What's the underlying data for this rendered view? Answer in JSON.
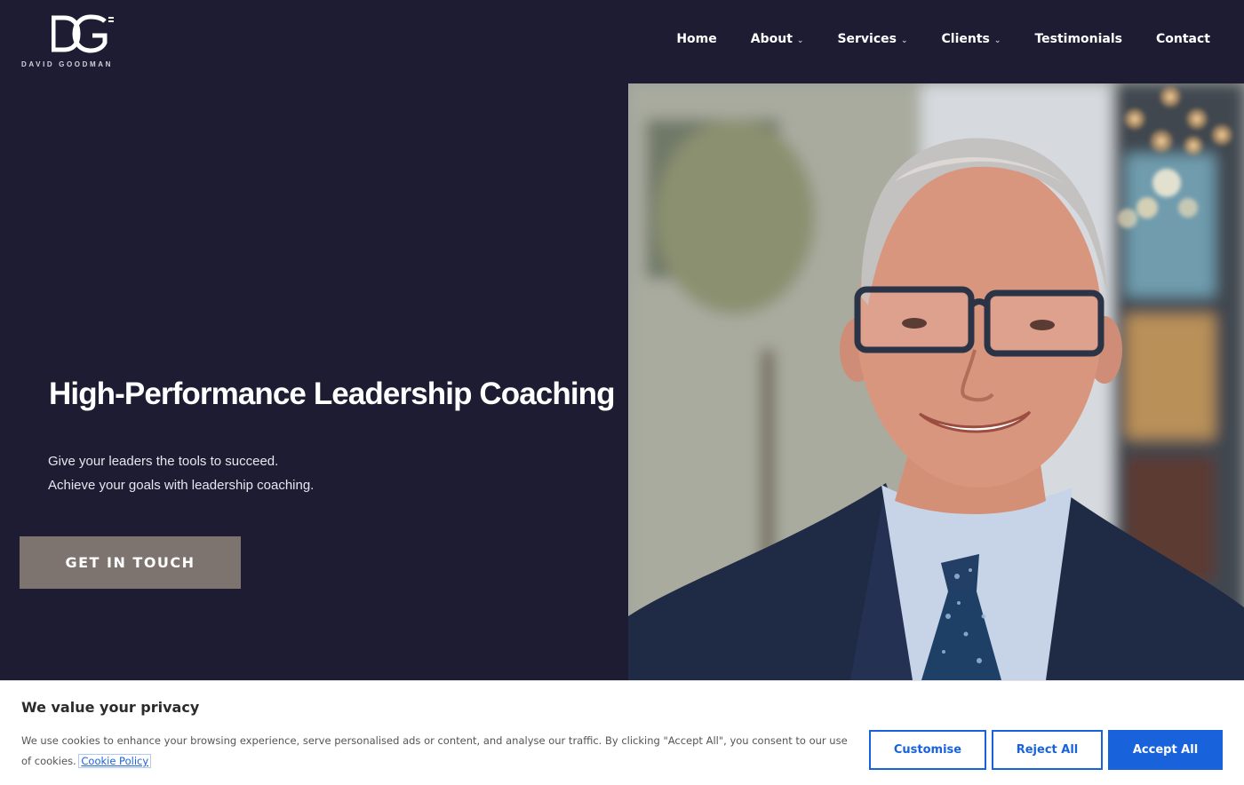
{
  "brand": {
    "logo_monogram": "DG",
    "logo_text": "DAVID GOODMAN"
  },
  "nav": {
    "items": [
      {
        "label": "Home",
        "dropdown": false
      },
      {
        "label": "About",
        "dropdown": true
      },
      {
        "label": "Services",
        "dropdown": true
      },
      {
        "label": "Clients",
        "dropdown": true
      },
      {
        "label": "Testimonials",
        "dropdown": false
      },
      {
        "label": "Contact",
        "dropdown": false
      }
    ]
  },
  "hero": {
    "title": "High-Performance Leadership Coaching",
    "subtitle_line1": "Give your leaders the tools to succeed.",
    "subtitle_line2": "Achieve your goals with leadership coaching.",
    "cta_label": "GET IN TOUCH"
  },
  "cookie": {
    "title": "We value your privacy",
    "text": "We use cookies to enhance your browsing experience, serve personalised ads or content, and analyse our traffic. By clicking \"Accept All\", you consent to our use of cookies.",
    "policy_link": "Cookie Policy",
    "customise_label": "Customise",
    "reject_label": "Reject All",
    "accept_label": "Accept All"
  },
  "colors": {
    "background": "#1d1c33",
    "cta": "#7d7470",
    "accent": "#1863dc"
  }
}
